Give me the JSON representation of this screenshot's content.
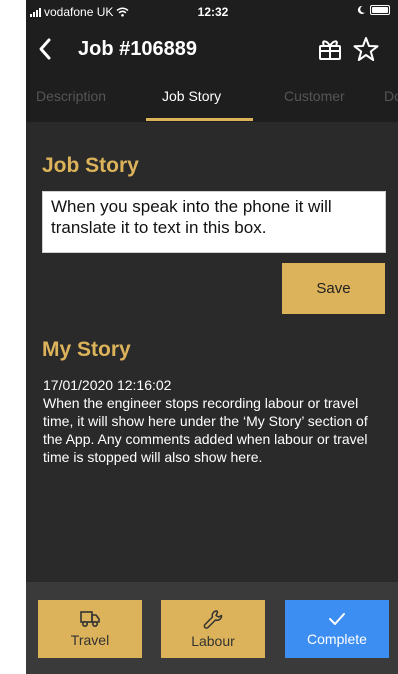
{
  "status_bar": {
    "carrier": "vodafone UK",
    "time": "12:32"
  },
  "header": {
    "title": "Job #106889"
  },
  "tabs": [
    {
      "label": "Description",
      "active": false
    },
    {
      "label": "Job Story",
      "active": true
    },
    {
      "label": "Customer",
      "active": false
    },
    {
      "label": "Do",
      "active": false
    }
  ],
  "job_story": {
    "heading": "Job Story",
    "input_text": "When you speak into the phone it will translate it to text in this box.",
    "save_label": "Save"
  },
  "my_story": {
    "heading": "My Story",
    "timestamp": "17/01/2020 12:16:02",
    "text": "When the engineer stops recording labour or travel time, it will show here under the ‘My Story’ section of the App. Any comments added when labour or travel time is stopped will also show here."
  },
  "bottom_actions": [
    {
      "label": "Travel",
      "icon": "truck-icon"
    },
    {
      "label": "Labour",
      "icon": "wrench-icon"
    },
    {
      "label": "Complete",
      "icon": "check-icon"
    }
  ],
  "colors": {
    "accent_gold": "#dcb35a",
    "complete_blue": "#3d8ef3",
    "background": "#2a2a2a",
    "header_background": "#1e1e1e"
  }
}
